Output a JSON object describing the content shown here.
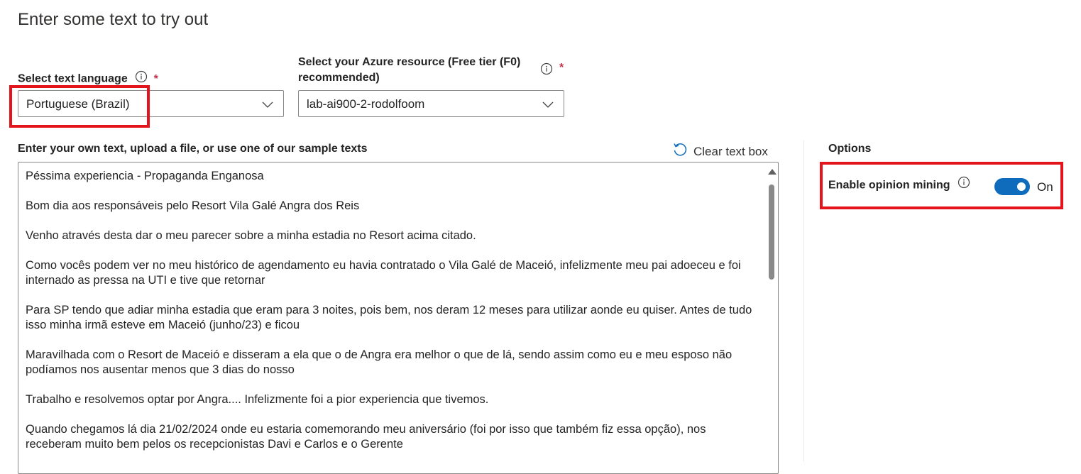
{
  "page_title": "Enter some text to try out",
  "language": {
    "label": "Select text language",
    "required_mark": "*",
    "selected": "Portuguese (Brazil)"
  },
  "resource": {
    "label_line1": "Select your Azure resource (Free tier (F0)",
    "label_line2": "recommended)",
    "required_mark": "*",
    "selected": "lab-ai900-2-rodolfoom"
  },
  "input_section": {
    "label": "Enter your own text, upload a file, or use one of our sample texts",
    "clear_label": "Clear text box",
    "paragraphs": [
      "Péssima experiencia - Propaganda Enganosa",
      "Bom dia aos responsáveis pelo Resort Vila Galé Angra dos Reis",
      "Venho através desta dar o meu parecer sobre a minha estadia no Resort acima citado.",
      "Como vocês podem ver no meu histórico de agendamento eu havia contratado o Vila Galé de Maceió, infelizmente meu pai adoeceu e foi internado as pressa na UTI e tive que retornar",
      "Para SP tendo que adiar minha estadia que eram para 3 noites, pois bem, nos deram 12 meses para utilizar aonde eu quiser. Antes de tudo isso minha irmã esteve em Maceió (junho/23) e ficou",
      "Maravilhada com o Resort de Maceió e disseram a ela que o de Angra era melhor o que de lá, sendo assim como eu e meu esposo não podíamos nos ausentar menos que 3 dias do nosso",
      "Trabalho e resolvemos optar por Angra.... Infelizmente foi a pior experiencia que tivemos.",
      "Quando chegamos lá dia 21/02/2024 onde eu estaria comemorando meu aniversário (foi por isso que também fiz essa opção), nos receberam muito bem pelos os recepcionistas Davi e Carlos e o Gerente"
    ]
  },
  "options": {
    "title": "Options",
    "opinion_mining_label": "Enable opinion mining",
    "toggle_state": "On",
    "enabled": true
  },
  "colors": {
    "accent": "#0f6cbd",
    "highlight": "#e3141b",
    "required": "#c4314b"
  }
}
